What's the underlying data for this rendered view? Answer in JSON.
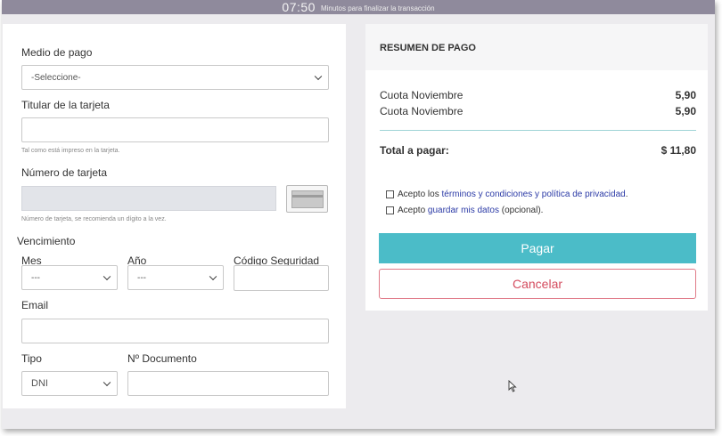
{
  "timer": {
    "time": "07:50",
    "text": "Minutos para finalizar la transacción"
  },
  "form": {
    "payment_method": {
      "label": "Medio de pago",
      "selected": "-Seleccione-"
    },
    "cardholder": {
      "label": "Titular de la tarjeta",
      "value": "",
      "hint": "Tal como está impreso en la tarjeta."
    },
    "card_number": {
      "label": "Número de tarjeta",
      "value": "",
      "hint": "Número de tarjeta, se recomienda un dígito a la vez."
    },
    "expiry": {
      "label": "Vencimiento"
    },
    "month": {
      "label": "Mes",
      "selected": "---"
    },
    "year": {
      "label": "Año",
      "selected": "---"
    },
    "security_code": {
      "label": "Código Seguridad",
      "value": ""
    },
    "email": {
      "label": "Email",
      "value": ""
    },
    "doc_type": {
      "label": "Tipo",
      "selected": "DNI"
    },
    "doc_number": {
      "label": "Nº Documento",
      "value": ""
    }
  },
  "summary": {
    "title": "RESUMEN DE PAGO",
    "items": [
      {
        "name": "Cuota Noviembre",
        "amount": "5,90"
      },
      {
        "name": "Cuota Noviembre",
        "amount": "5,90"
      }
    ],
    "total_label": "Total a pagar:",
    "total_value": "$ 11,80",
    "terms": {
      "prefix": "Acepto los ",
      "link": "términos y condiciones y política de privacidad",
      "suffix": "."
    },
    "save_data": {
      "prefix": "Acepto ",
      "link": "guardar mis datos",
      "suffix": " (opcional)."
    },
    "pay_label": "Pagar",
    "cancel_label": "Cancelar"
  },
  "colors": {
    "accent": "#4bbcc8",
    "cancel": "#d44c5f",
    "link": "#2b3aa6",
    "timer_bar": "#8f8a9c"
  },
  "icons": {
    "card": "credit-card-icon",
    "cursor": "mouse-pointer-icon",
    "dropdown": "chevron-down-icon"
  }
}
